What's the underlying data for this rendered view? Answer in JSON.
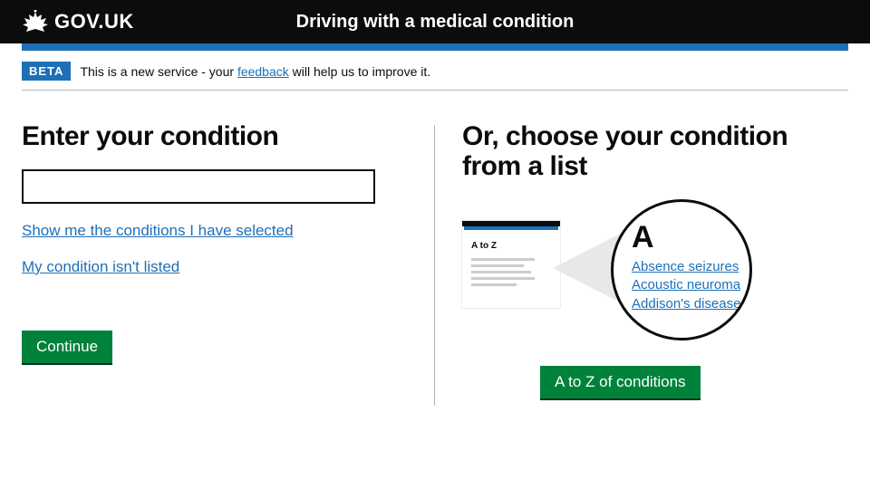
{
  "header": {
    "logo_text": "GOV.UK",
    "title": "Driving with a medical condition"
  },
  "phase": {
    "tag": "BETA",
    "text_before": "This is a new service - your ",
    "link": "feedback",
    "text_after": " will help us to improve it."
  },
  "left": {
    "heading": "Enter your condition",
    "input_value": "",
    "link_show": "Show me the conditions I have selected",
    "link_not_listed": "My condition isn't listed",
    "continue": "Continue"
  },
  "right": {
    "heading": "Or, choose your condition from a list",
    "mini_label": "A to Z",
    "mag_letter": "A",
    "mag_links": [
      "Absence seizures",
      "Acoustic neuroma",
      "Addison's disease"
    ],
    "atoz_button": "A to Z of conditions"
  }
}
